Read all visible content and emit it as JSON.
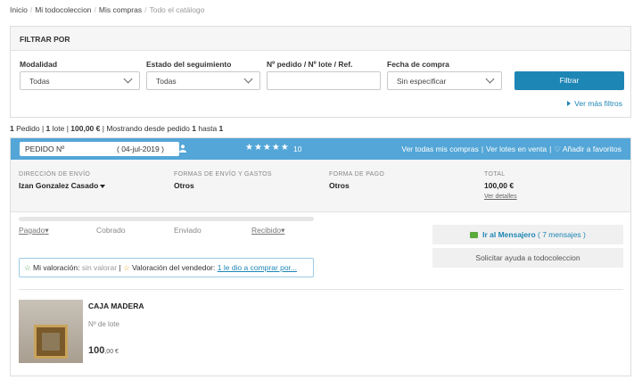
{
  "breadcrumb": {
    "items": [
      "Inicio",
      "Mi todocoleccion",
      "Mis compras"
    ],
    "current": "Todo el catálogo"
  },
  "filter": {
    "title": "FILTRAR POR",
    "modalidad_label": "Modalidad",
    "modalidad_value": "Todas",
    "estado_label": "Estado del seguimiento",
    "estado_value": "Todas",
    "pedido_label": "Nº pedido / Nº lote / Ref.",
    "pedido_value": "",
    "fecha_label": "Fecha de compra",
    "fecha_value": "Sin especificar",
    "button": "Filtrar",
    "more": "Ver más filtros"
  },
  "summary": {
    "pedidos": "1",
    "pedido_word": "Pedido",
    "lotes": "1",
    "lote_word": "lote",
    "total": "100,00 €",
    "mostrando": "Mostrando desde pedido",
    "desde": "1",
    "hasta_word": "hasta",
    "hasta": "1"
  },
  "order": {
    "pedido_label": "PEDIDO Nº",
    "date": "( 04-jul-2019 )",
    "rating_stars": 5,
    "stars_text": "★★★★★",
    "rating_count": "10",
    "links": [
      "Ver todas mis compras",
      "Ver lotes en venta",
      "Añadir a favoritos"
    ],
    "direccion_label": "DIRECCIÓN DE ENVÍO",
    "direccion_value": "Izan Gonzalez Casado",
    "formas_envio_label": "FORMAS DE ENVÍO Y GASTOS",
    "formas_envio_value": "Otros",
    "forma_pago_label": "FORMA DE PAGO",
    "forma_pago_value": "Otros",
    "total_label": "TOTAL",
    "total_value": "100,00 €",
    "ver_detalles": "Ver detalles",
    "steps": [
      "Pagado",
      "Cobrado",
      "Enviado",
      "Recibido"
    ],
    "mensajero_label": "Ir al Mensajero",
    "mensajero_count": "( 7 mensajes )",
    "ayuda": "Solicitar ayuda a todocoleccion",
    "mi_valoracion_label": "Mi valoración:",
    "mi_valoracion_value": "sin valorar",
    "valoracion_vendedor_label": "Valoración del vendedor:",
    "valoracion_vendedor_link": "1 le dio a comprar por...",
    "item_title": "CAJA MADERA",
    "item_lote_label": "Nº de lote",
    "item_price": "100",
    "item_price_decimals": ",00 €"
  },
  "colors": {
    "accent": "#1e86b5",
    "header_bar": "#53a6d7",
    "star_green": "#4aa24a",
    "star_orange": "#e5a021"
  }
}
